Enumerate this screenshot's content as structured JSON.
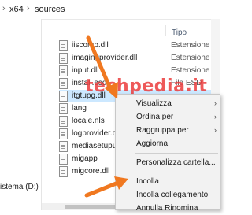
{
  "breadcrumb": {
    "items": [
      "x64",
      "sources"
    ],
    "separator": "›"
  },
  "columns": {
    "type": "Tipo"
  },
  "sidebar": {
    "drive_label": "istema (D:)"
  },
  "files": [
    {
      "name": "iiscomp.dll",
      "type": "Estensione dell'applicazione"
    },
    {
      "name": "imagingprovider.dll",
      "type": "Estensione dell'applicazione"
    },
    {
      "name": "input.dll",
      "type": "Estensione dell'applicazione"
    },
    {
      "name": "install.esd",
      "type": "File ESD"
    },
    {
      "name": "itgtupg.dll",
      "type": ""
    },
    {
      "name": "lang",
      "type": ""
    },
    {
      "name": "locale.nls",
      "type": ""
    },
    {
      "name": "logprovider.dll",
      "type": ""
    },
    {
      "name": "mediasetupui",
      "type": ""
    },
    {
      "name": "migapp",
      "type": ""
    },
    {
      "name": "migcore.dll",
      "type": ""
    }
  ],
  "watermark": "techpedia.it",
  "context_menu": {
    "items": [
      "Visualizza",
      "Ordina per",
      "Raggruppa per",
      "Aggiorna",
      "Personalizza cartella...",
      "Incolla",
      "Incolla collegamento",
      "Annulla Rinomina"
    ]
  },
  "colors": {
    "accent_arrow": "#f07820",
    "watermark": "#eb3c3c",
    "selection": "#cce8ff"
  }
}
